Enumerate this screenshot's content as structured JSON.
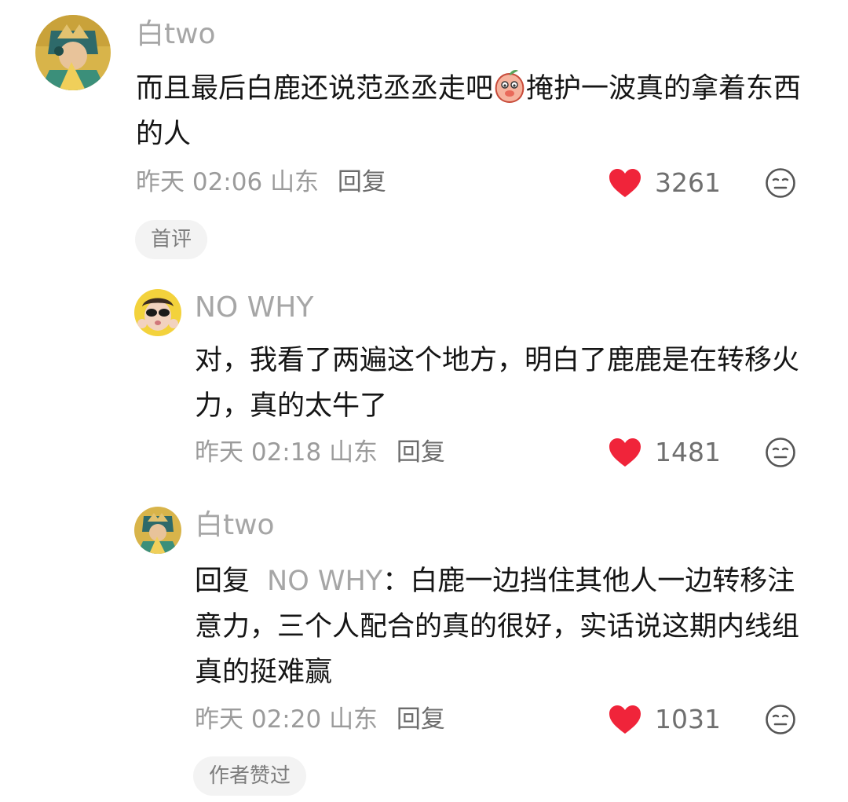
{
  "comments": [
    {
      "username": "白two",
      "text_before_emoji": "而且最后白鹿还说范丞丞走吧",
      "inline_emoji": "peach-face-emoji",
      "text_after_emoji": "掩护一波真的拿着东西的人",
      "time": "昨天 02:06",
      "location": "山东",
      "reply_label": "回复",
      "likes": "3261",
      "badge": "首评"
    }
  ],
  "replies": [
    {
      "username": "NO WHY",
      "text": "对，我看了两遍这个地方，明白了鹿鹿是在转移火力，真的太牛了",
      "time": "昨天 02:18",
      "location": "山东",
      "reply_label": "回复",
      "likes": "1481"
    },
    {
      "username": "白two",
      "reply_prefix": "回复",
      "mention": "NO WHY",
      "separator": "：",
      "text": "白鹿一边挡住其他人一边转移注意力，三个人配合的真的很好，实话说这期内线组真的挺难赢",
      "time": "昨天 02:20",
      "location": "山东",
      "reply_label": "回复",
      "likes": "1031",
      "badge": "作者赞过"
    }
  ],
  "icons": {
    "like": "heart-icon",
    "reaction": "neutral-face-icon"
  },
  "colors": {
    "like": "#f0243a",
    "username": "#a6a6a6",
    "text": "#151515",
    "meta": "#9b9b9b"
  }
}
